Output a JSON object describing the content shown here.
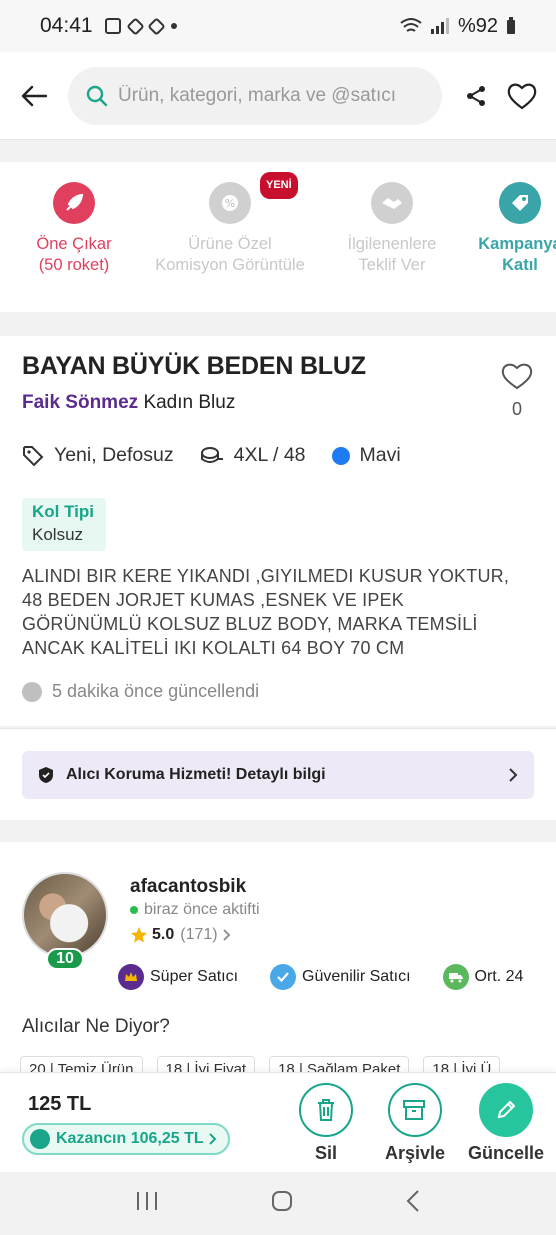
{
  "status_bar": {
    "time": "04:41",
    "battery": "%92"
  },
  "search": {
    "placeholder": "Ürün, kategori, marka ve @satıcı"
  },
  "actions": [
    {
      "label": "Öne Çıkar",
      "sub": "(50 roket)",
      "color": "#e0405e"
    },
    {
      "label": "Ürüne Özel",
      "sub": "Komisyon Görüntüle",
      "color": "#c8c8c8",
      "badge": "YENİ"
    },
    {
      "label": "İlgilenenlere",
      "sub": "Teklif Ver",
      "color": "#c8c8c8"
    },
    {
      "label": "Kampanya",
      "sub": "Katıl",
      "color": "#3aa5a8"
    }
  ],
  "product": {
    "title": "BAYAN BÜYÜK BEDEN BLUZ",
    "brand": "Faik Sönmez",
    "category": "Kadın Bluz",
    "likes": "0",
    "condition": "Yeni, Defosuz",
    "size": "4XL / 48",
    "color_name": "Mavi",
    "color_hex": "#1e7bf0",
    "spec_key": "Kol Tipi",
    "spec_value": "Kolsuz",
    "description": "ALINDI BIR KERE YIKANDI ,GIYILMEDI KUSUR YOKTUR, 48 BEDEN JORJET KUMAS ,ESNEK VE IPEK GÖRÜNÜMLÜ KOLSUZ BLUZ BODY, MARKA TEMSİLİ ANCAK KALİTELİ IKI KOLALTI 64 BOY 70 CM",
    "updated": "5 dakika önce güncellendi"
  },
  "protection": {
    "label": "Alıcı Koruma Hizmeti! Detaylı bilgi"
  },
  "seller": {
    "name": "afacantosbik",
    "status": "biraz önce aktifti",
    "rating": "5.0",
    "rating_count": "(171)",
    "level": "10",
    "badges": [
      "Süper Satıcı",
      "Güvenilir Satıcı",
      "Ort. 24"
    ],
    "buyers_title": "Alıcılar Ne Diyor?",
    "reviews": [
      "20 | Temiz Ürün",
      "18 | İyi Fiyat",
      "18 | Sağlam Paket",
      "18 | İyi Ü"
    ]
  },
  "bottom": {
    "price": "125 TL",
    "earn": "Kazancın 106,25 TL",
    "delete": "Sil",
    "archive": "Arşivle",
    "update": "Güncelle"
  },
  "colors": {
    "accent": "#18a58a",
    "brand_purple": "#5b2c8e",
    "badge_red": "#c8102e"
  }
}
